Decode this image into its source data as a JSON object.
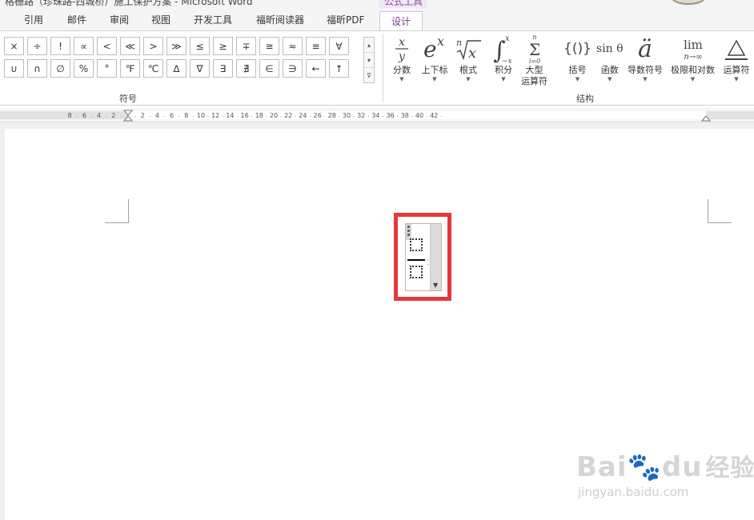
{
  "window": {
    "title": "格栅路（珍珠路-西城桥）施工保护方案 - Microsoft Word",
    "contextual_tab": "公式工具"
  },
  "tabs": [
    {
      "label": "引用"
    },
    {
      "label": "邮件"
    },
    {
      "label": "审阅"
    },
    {
      "label": "视图"
    },
    {
      "label": "开发工具"
    },
    {
      "label": "福昕阅读器"
    },
    {
      "label": "福昕PDF"
    },
    {
      "label": "设计",
      "active": true
    }
  ],
  "symbols": {
    "row1": [
      "×",
      "÷",
      "!",
      "∝",
      "<",
      "≪",
      ">",
      "≫",
      "≤",
      "≥",
      "∓",
      "≅",
      "≈",
      "≡",
      "∀"
    ],
    "row2": [
      "∪",
      "∩",
      "∅",
      "%",
      "°",
      "℉",
      "℃",
      "∆",
      "∇",
      "∃",
      "∄",
      "∈",
      "∋",
      "←",
      "↑"
    ],
    "scroll": [
      "▴",
      "▾",
      "⊽"
    ],
    "group_label": "符号"
  },
  "structures": {
    "group_label": "结构",
    "items": [
      {
        "label": "分数",
        "glyph": "x/y"
      },
      {
        "label": "上下标",
        "glyph": "eˣ"
      },
      {
        "label": "根式",
        "glyph": "ⁿ√x"
      },
      {
        "label": "积分",
        "glyph": "∫"
      },
      {
        "label": "大型",
        "label2": "运算符",
        "glyph": "Σ"
      },
      {
        "label": "括号",
        "glyph": "{()}"
      },
      {
        "label": "函数",
        "glyph": "sin θ"
      },
      {
        "label": "导数符号",
        "glyph": "ä"
      },
      {
        "label": "极限和对数",
        "glyph": "lim"
      },
      {
        "label": "运算符",
        "glyph": "Δ"
      }
    ]
  },
  "ruler": {
    "labels": [
      "8",
      "6",
      "4",
      "2",
      "2",
      "4",
      "6",
      "8",
      "10",
      "12",
      "14",
      "16",
      "18",
      "20",
      "22",
      "24",
      "26",
      "28",
      "30",
      "32",
      "34",
      "36",
      "38",
      "40",
      "42"
    ]
  },
  "equation": {
    "type": "fraction",
    "numerator_placeholder": "",
    "denominator_placeholder": ""
  },
  "watermark": {
    "logo": "Bai",
    "logo_tail": "du",
    "logo_cn": "经验",
    "url": "jingyan.baidu.com"
  },
  "colors": {
    "accent": "#7a3a8e",
    "highlight": "#e5383b"
  }
}
